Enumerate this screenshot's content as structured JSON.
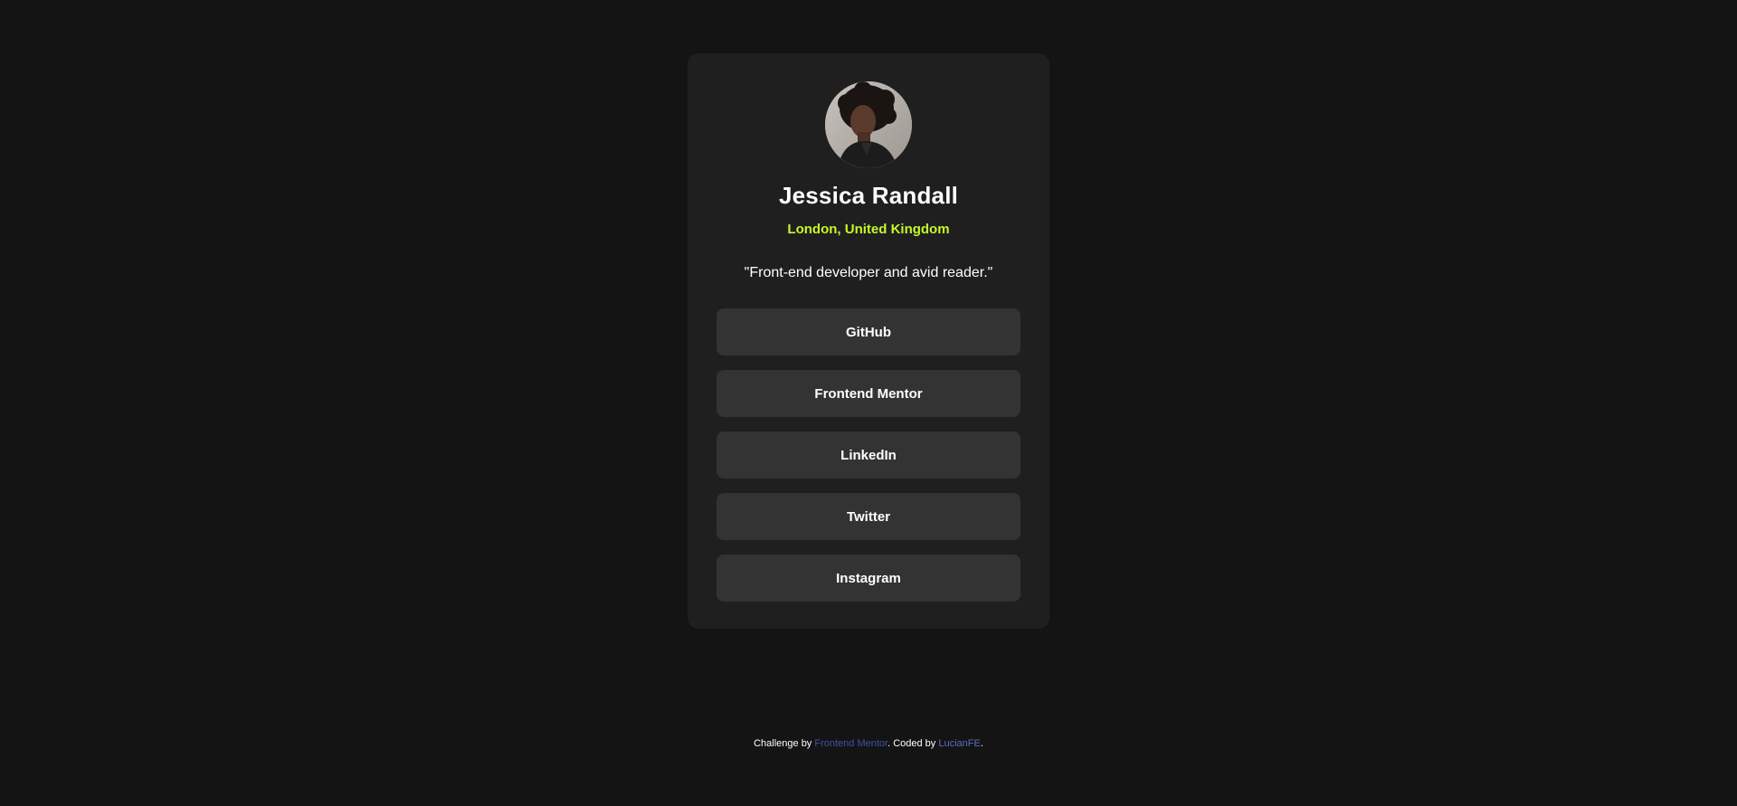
{
  "profile": {
    "avatar_icon": "profile-photo",
    "name": "Jessica Randall",
    "location": "London, United Kingdom",
    "bio": "\"Front-end developer and avid reader.\""
  },
  "links": [
    {
      "label": "GitHub"
    },
    {
      "label": "Frontend Mentor"
    },
    {
      "label": "LinkedIn"
    },
    {
      "label": "Twitter"
    },
    {
      "label": "Instagram"
    }
  ],
  "footer": {
    "prefix": "Challenge by ",
    "challenge_link": "Frontend Mentor",
    "middle": ". Coded by ",
    "author_link": "LucianFE",
    "suffix": "."
  },
  "colors": {
    "background": "#141414",
    "card": "#1f1f1f",
    "button": "#333333",
    "accent": "#c4f82a",
    "link": "#3e52a3"
  }
}
